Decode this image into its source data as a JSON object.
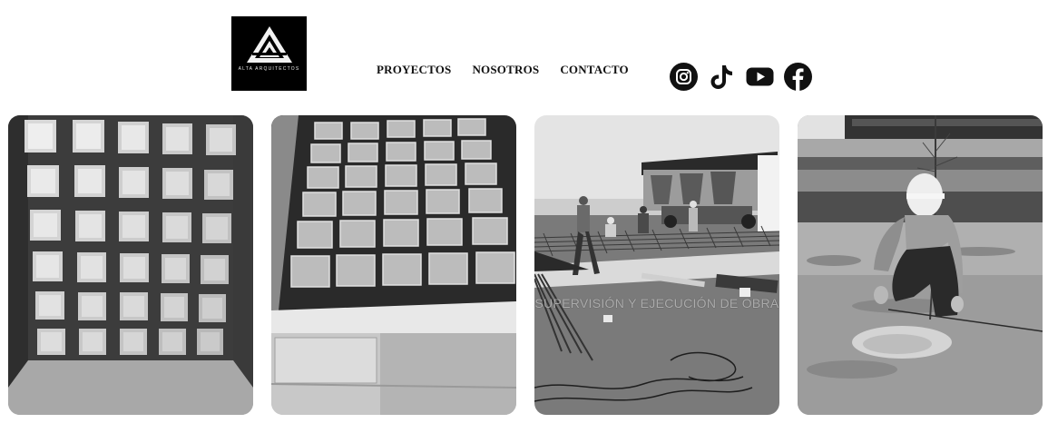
{
  "header": {
    "logo_text": "ALTA ARQUITECTOS",
    "nav": [
      {
        "label": "PROYECTOS"
      },
      {
        "label": "NOSOTROS"
      },
      {
        "label": "CONTACTO"
      }
    ],
    "social": [
      "instagram-icon",
      "tiktok-icon",
      "youtube-icon",
      "facebook-icon"
    ]
  },
  "gallery": {
    "images": [
      {
        "subject": "glass-block-wall-photo"
      },
      {
        "subject": "glass-block-formwork-photo"
      },
      {
        "subject": "construction-site-photo",
        "caption": "SUPERVISIÓN Y EJECUCIÓN DE OBRA"
      },
      {
        "subject": "tree-planting-photo"
      }
    ]
  },
  "colors": {
    "background": "#ffffff",
    "text": "#111111",
    "logo_bg": "#000000"
  }
}
